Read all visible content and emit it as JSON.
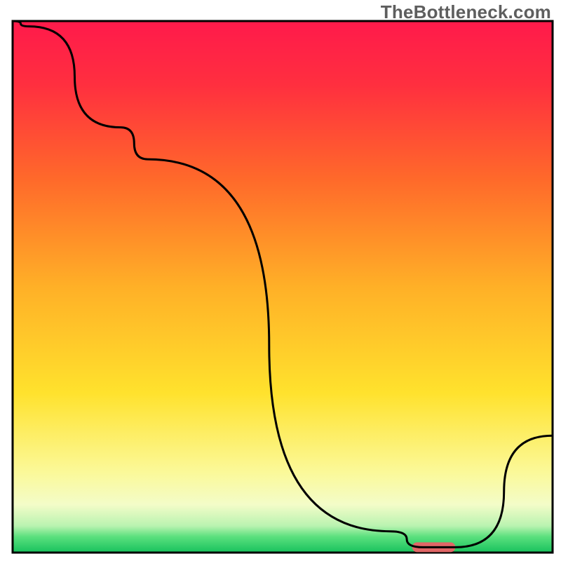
{
  "watermark": "TheBottleneck.com",
  "chart_data": {
    "type": "line",
    "title": "",
    "xlabel": "",
    "ylabel": "",
    "xlim": [
      0,
      100
    ],
    "ylim": [
      0,
      100
    ],
    "x": [
      0,
      3,
      20,
      25,
      70,
      76,
      82,
      100
    ],
    "values": [
      100,
      99,
      80,
      74,
      4,
      1,
      1,
      22
    ],
    "bottleneck_marker": {
      "x_start": 74,
      "x_end": 82,
      "y": 1
    },
    "gradient_stops": [
      {
        "pct": 0,
        "color": "#ff1a4b"
      },
      {
        "pct": 12,
        "color": "#ff2f3f"
      },
      {
        "pct": 30,
        "color": "#ff6a2a"
      },
      {
        "pct": 50,
        "color": "#ffb027"
      },
      {
        "pct": 70,
        "color": "#ffe22d"
      },
      {
        "pct": 85,
        "color": "#fbf99a"
      },
      {
        "pct": 91,
        "color": "#f3fcc8"
      },
      {
        "pct": 95,
        "color": "#b9f3b0"
      },
      {
        "pct": 97,
        "color": "#5be07e"
      },
      {
        "pct": 100,
        "color": "#17c25d"
      }
    ]
  }
}
